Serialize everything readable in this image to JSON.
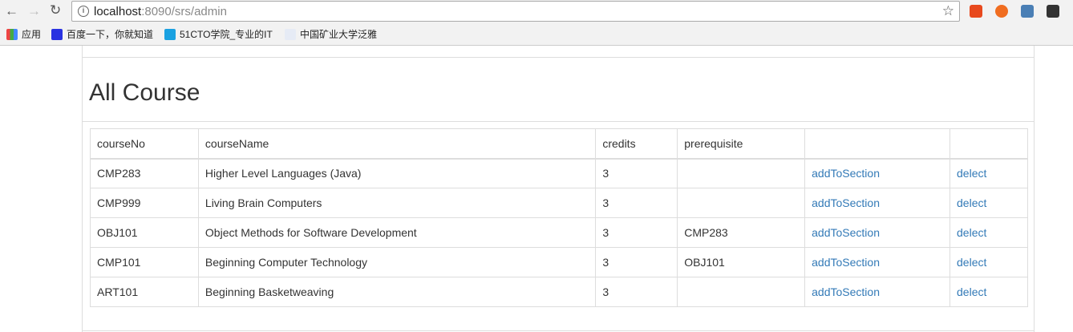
{
  "browser": {
    "url_host": "localhost",
    "url_path": ":8090/srs/admin",
    "bookmarks": [
      {
        "label": "应用"
      },
      {
        "label": "百度一下，你就知道"
      },
      {
        "label": "51CTO学院_专业的IT"
      },
      {
        "label": "中国矿业大学泛雅"
      }
    ]
  },
  "page": {
    "title": "All Course",
    "columns": [
      "courseNo",
      "courseName",
      "credits",
      "prerequisite",
      "",
      ""
    ],
    "rows": [
      {
        "no": "CMP283",
        "name": "Higher Level Languages (Java)",
        "credits": "3",
        "prereq": "",
        "add": "addToSection",
        "del": "delect"
      },
      {
        "no": "CMP999",
        "name": "Living Brain Computers",
        "credits": "3",
        "prereq": "",
        "add": "addToSection",
        "del": "delect"
      },
      {
        "no": "OBJ101",
        "name": "Object Methods for Software Development",
        "credits": "3",
        "prereq": "CMP283",
        "add": "addToSection",
        "del": "delect"
      },
      {
        "no": "CMP101",
        "name": "Beginning Computer Technology",
        "credits": "3",
        "prereq": "OBJ101",
        "add": "addToSection",
        "del": "delect"
      },
      {
        "no": "ART101",
        "name": "Beginning Basketweaving",
        "credits": "3",
        "prereq": "",
        "add": "addToSection",
        "del": "delect"
      }
    ]
  }
}
